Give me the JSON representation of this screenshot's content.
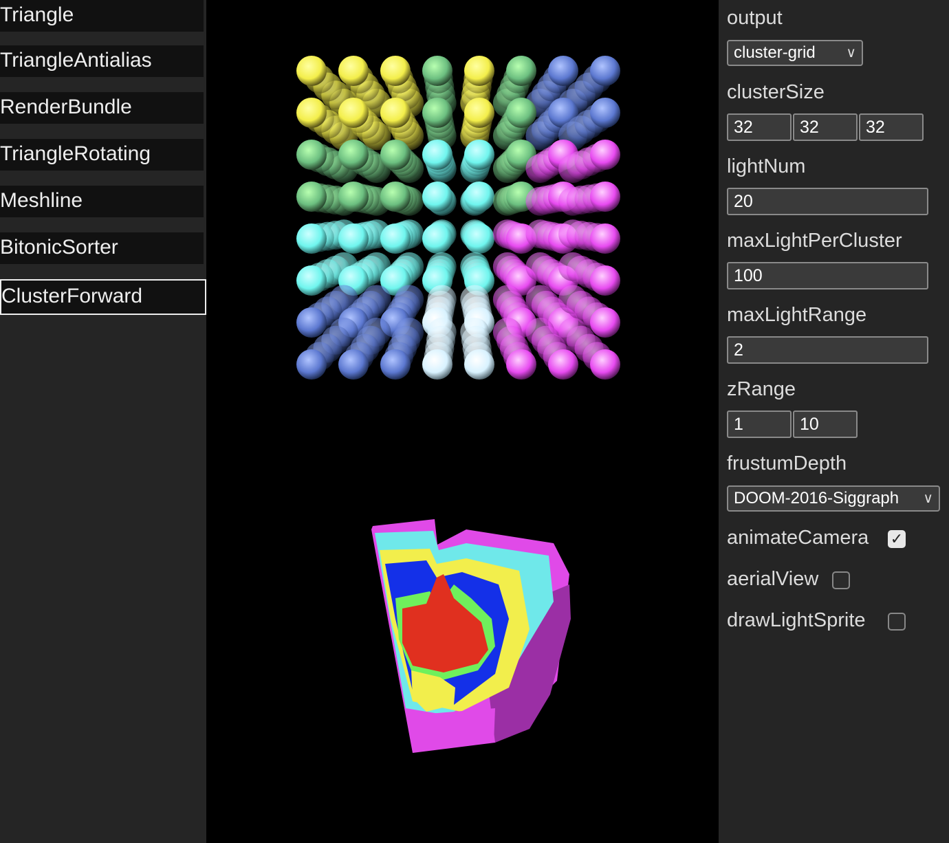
{
  "nav": {
    "items": [
      {
        "label": "Triangle"
      },
      {
        "label": "TriangleAntialias"
      },
      {
        "label": "RenderBundle"
      },
      {
        "label": "TriangleRotating"
      },
      {
        "label": "Meshline"
      },
      {
        "label": "BitonicSorter"
      },
      {
        "label": "ClusterForward"
      }
    ],
    "active_label": "ClusterForward"
  },
  "controls": {
    "output": {
      "label": "output",
      "value": "cluster-grid"
    },
    "clusterSize": {
      "label": "clusterSize",
      "values": [
        "32",
        "32",
        "32"
      ]
    },
    "lightNum": {
      "label": "lightNum",
      "value": "20"
    },
    "maxLightPerCluster": {
      "label": "maxLightPerCluster",
      "value": "100"
    },
    "maxLightRange": {
      "label": "maxLightRange",
      "value": "2"
    },
    "zRange": {
      "label": "zRange",
      "values": [
        "1",
        "10"
      ]
    },
    "frustumDepth": {
      "label": "frustumDepth",
      "value": "DOOM-2016-Siggraph"
    },
    "animateCamera": {
      "label": "animateCamera",
      "checked": true
    },
    "aerialView": {
      "label": "aerialView",
      "checked": false
    },
    "drawLightSprite": {
      "label": "drawLightSprite",
      "checked": false
    }
  },
  "icons": {
    "dropdown": "chevron-down-icon",
    "check": "check-icon"
  },
  "colors": {
    "viewport_bg": "#000000",
    "panel_bg": "#252525",
    "nav_bg": "#111111"
  }
}
